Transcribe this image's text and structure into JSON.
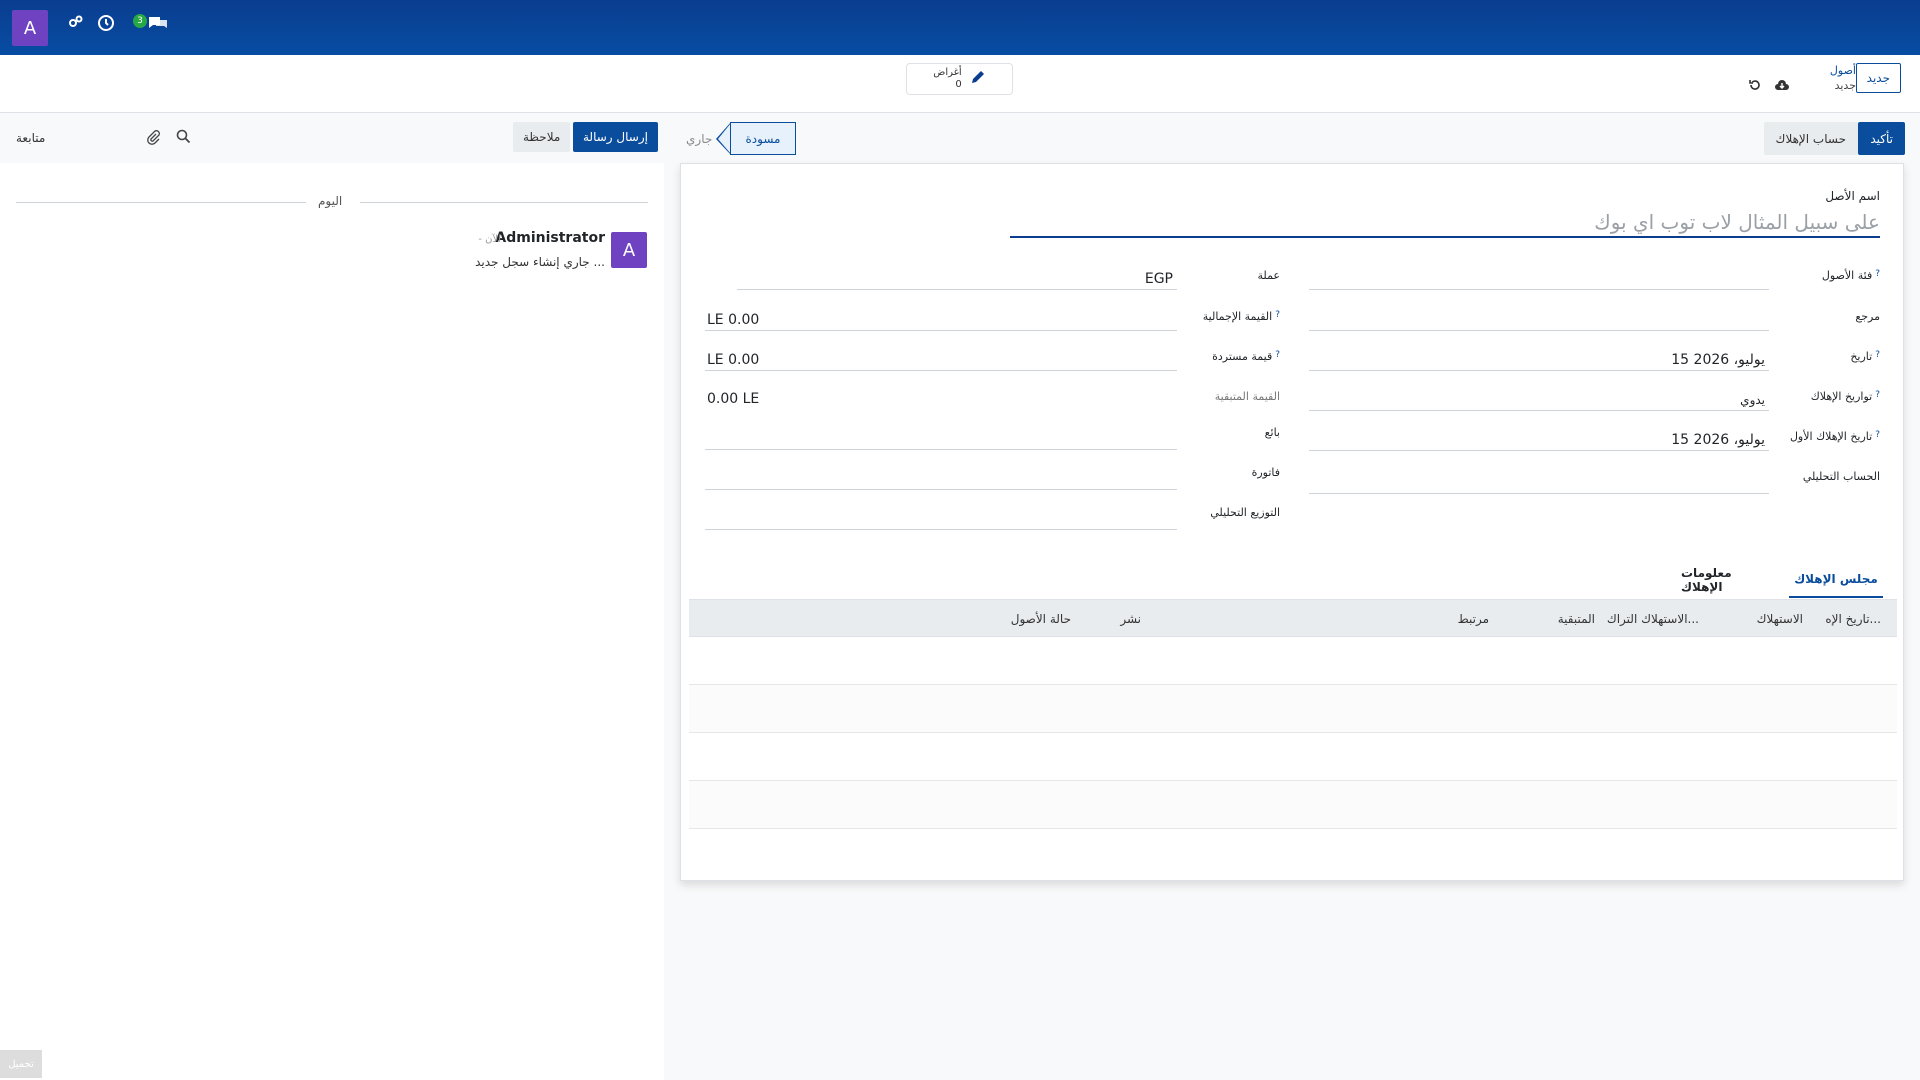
{
  "navbar": {
    "user_initial": "A",
    "messages_count": "3"
  },
  "control_panel": {
    "new_button": "جديد",
    "breadcrumb_parent": "أصول",
    "breadcrumb_current": "جديد",
    "smart_button_label": "أغراض",
    "smart_button_count": "0"
  },
  "statusbar": {
    "confirm_button": "تأكيد",
    "depreciation_account_button": "حساب الإهلاك",
    "stage_draft": "مسودة",
    "stage_running": "جاري"
  },
  "form": {
    "name_label": "اسم الأصل",
    "name_placeholder": "على سبيل المثال لاب توب اي بوك",
    "asset_category_label": "فئة الأصول",
    "reference_label": "مرجع",
    "date_label": "تاريخ",
    "date_value": "15 يوليو، 2026",
    "depreciation_dates_label": "تواريخ الإهلاك",
    "depreciation_dates_value": "يدوي",
    "first_depreciation_date_label": "تاريخ الإهلاك الأول",
    "first_depreciation_date_value": "15 يوليو، 2026",
    "analytic_account_label": "الحساب التحليلي",
    "currency_label": "عملة",
    "currency_value": "EGP",
    "gross_value_label": "القيمة الإجمالية",
    "gross_value_value": "LE 0.00",
    "salvage_value_label": "قيمة مستردة",
    "salvage_value_value": "LE 0.00",
    "residual_value_label": "القيمة المتبقية",
    "residual_value_value": "0.00 LE",
    "vendor_label": "بائع",
    "invoice_label": "فاتورة",
    "analytic_distribution_label": "التوزيع التحليلي"
  },
  "tabs": {
    "depreciation_board": "مجلس الإهلاك",
    "depreciation_info": "معلومات الإهلاك"
  },
  "table": {
    "columns": [
      "تاريخ الإه...",
      "الاستهلاك",
      "الاستهلاك التراك...",
      "المتبقية",
      "مرتبط",
      "نشر",
      "حالة الأصول"
    ]
  },
  "chatter": {
    "send_message": "إرسال رسالة",
    "log_note": "ملاحظة",
    "follow": "متابعة",
    "today": "اليوم",
    "author": "Administrator",
    "time": "- الآن",
    "body": "جاري إنشاء سجل جديد ...",
    "author_initial": "A",
    "load_more": "تحميل"
  },
  "colors": {
    "navbar": "#074da3",
    "primary": "#0a4d9d",
    "avatar": "#6f42c1",
    "badge": "#28a745"
  }
}
